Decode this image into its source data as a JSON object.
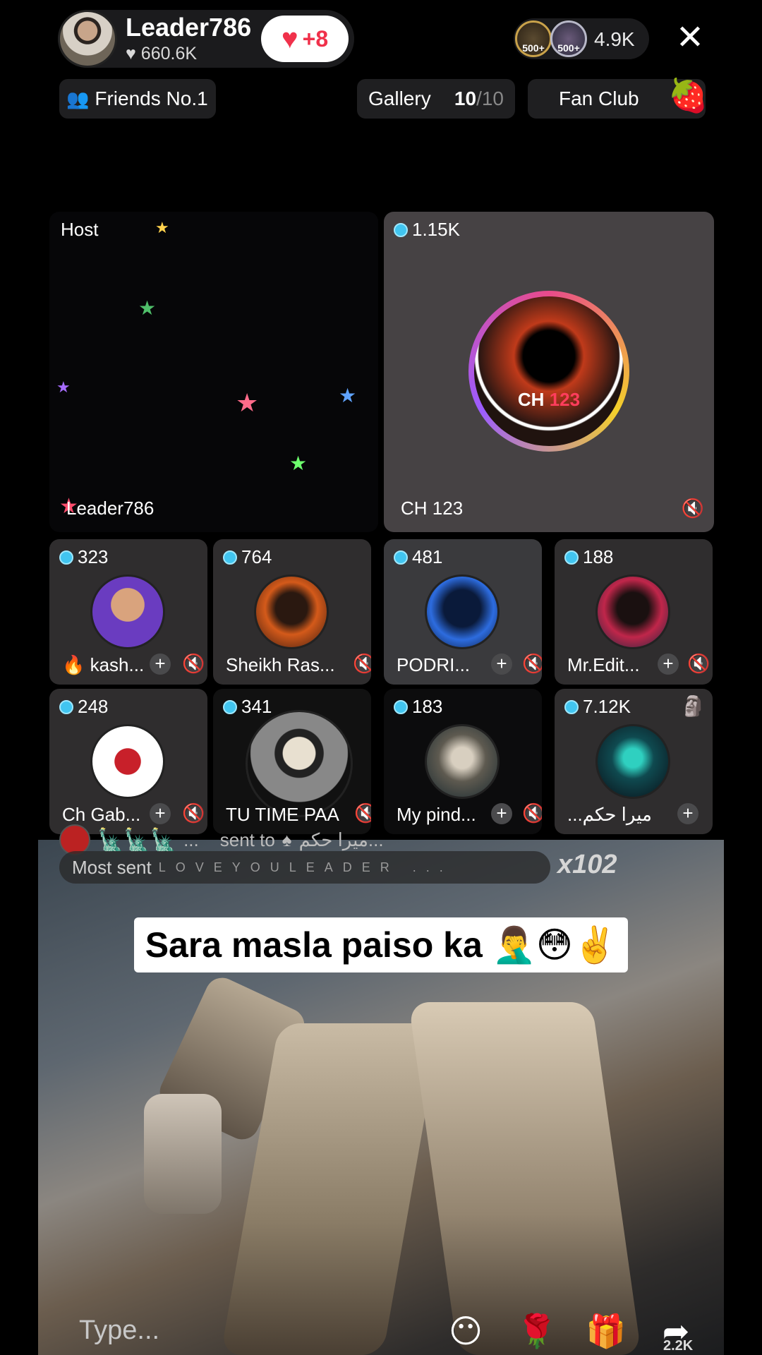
{
  "host": {
    "name": "Leader786",
    "likes": "660.6K",
    "follow_badge": "+8"
  },
  "viewers": {
    "badges": [
      "500+",
      "500+"
    ],
    "count": "4.9K"
  },
  "chips": {
    "friends": "Friends No.1",
    "gallery_label": "Gallery",
    "gallery_current": "10",
    "gallery_total": "/10",
    "fanclub": "Fan Club"
  },
  "seats": {
    "host": {
      "label": "Host",
      "name": "Leader786"
    },
    "big": {
      "count": "1.15K",
      "name": "CH 123",
      "album_main": "CH",
      "album_num": "123"
    },
    "row1": [
      {
        "count": "323",
        "name": "🔥 kash..."
      },
      {
        "count": "764",
        "name": "Sheikh Ras..."
      },
      {
        "count": "481",
        "name": "PODRI..."
      },
      {
        "count": "188",
        "name": "Mr.Edit..."
      }
    ],
    "row2": [
      {
        "count": "248",
        "name": "Ch Gab..."
      },
      {
        "count": "341",
        "name": "TU TIME PAA"
      },
      {
        "count": "183",
        "name": "My pind..."
      },
      {
        "count": "7.12K",
        "name": "...میرا حکم"
      }
    ]
  },
  "gift": {
    "sender_tail": "...",
    "sent_to": "sent to",
    "recipient": "میرا حکم...",
    "most_sent_label": "Most sent",
    "most_sent_letters": "LOVEYOULEADER ...",
    "multiplier": "x102"
  },
  "caption": "Sara masla paiso ka 🤦‍♂️😳✌️",
  "bottom": {
    "type_placeholder": "Type...",
    "share_count": "2.2K"
  }
}
